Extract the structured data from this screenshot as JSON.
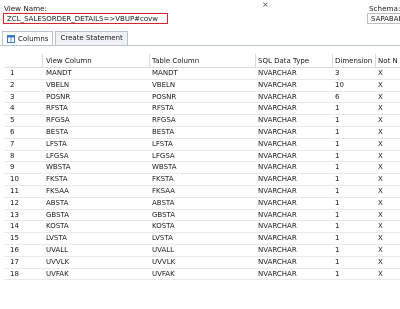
{
  "header": {
    "view_name_label": "View Name:",
    "view_name_value": "ZCL_SALESORDER_DETAILS=>VBUP#covw",
    "schema_label": "Schema:",
    "schema_value": "SAPABAP",
    "close_glyph": "×"
  },
  "tabs": [
    {
      "label": "Columns",
      "icon": "columns-table-icon",
      "active": true
    },
    {
      "label": "Create Statement",
      "active": false
    }
  ],
  "table": {
    "columns": [
      "",
      "View Column",
      "Table Column",
      "SQL Data Type",
      "Dimension",
      "Not N"
    ],
    "rows": [
      [
        "1",
        "MANDT",
        "MANDT",
        "NVARCHAR",
        "3",
        "X"
      ],
      [
        "2",
        "VBELN",
        "VBELN",
        "NVARCHAR",
        "10",
        "X"
      ],
      [
        "3",
        "POSNR",
        "POSNR",
        "NVARCHAR",
        "6",
        "X"
      ],
      [
        "4",
        "RFSTA",
        "RFSTA",
        "NVARCHAR",
        "1",
        "X"
      ],
      [
        "5",
        "RFGSA",
        "RFGSA",
        "NVARCHAR",
        "1",
        "X"
      ],
      [
        "6",
        "BESTA",
        "BESTA",
        "NVARCHAR",
        "1",
        "X"
      ],
      [
        "7",
        "LFSTA",
        "LFSTA",
        "NVARCHAR",
        "1",
        "X"
      ],
      [
        "8",
        "LFGSA",
        "LFGSA",
        "NVARCHAR",
        "1",
        "X"
      ],
      [
        "9",
        "WBSTA",
        "WBSTA",
        "NVARCHAR",
        "1",
        "X"
      ],
      [
        "10",
        "FKSTA",
        "FKSTA",
        "NVARCHAR",
        "1",
        "X"
      ],
      [
        "11",
        "FKSAA",
        "FKSAA",
        "NVARCHAR",
        "1",
        "X"
      ],
      [
        "12",
        "ABSTA",
        "ABSTA",
        "NVARCHAR",
        "1",
        "X"
      ],
      [
        "13",
        "GBSTA",
        "GBSTA",
        "NVARCHAR",
        "1",
        "X"
      ],
      [
        "14",
        "KOSTA",
        "KOSTA",
        "NVARCHAR",
        "1",
        "X"
      ],
      [
        "15",
        "LVSTA",
        "LVSTA",
        "NVARCHAR",
        "1",
        "X"
      ],
      [
        "16",
        "UVALL",
        "UVALL",
        "NVARCHAR",
        "1",
        "X"
      ],
      [
        "17",
        "UVVLK",
        "UVVLK",
        "NVARCHAR",
        "1",
        "X"
      ],
      [
        "18",
        "UVFAK",
        "UVFAK",
        "NVARCHAR",
        "1",
        "X"
      ]
    ]
  },
  "colors": {
    "highlight_border": "#d9262b",
    "tab_border": "#b9c4d0",
    "row_divider": "#e6e9ee"
  }
}
